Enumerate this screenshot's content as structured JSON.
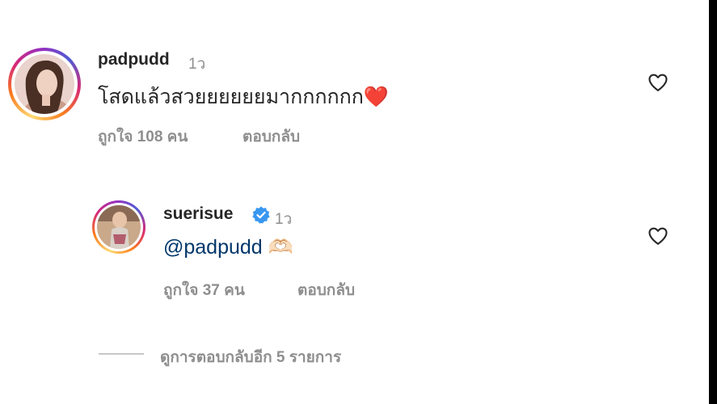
{
  "comment": {
    "username": "padpudd",
    "time": "1ว",
    "text": "โสดแล้วสวยยยยยยมากกกกกก",
    "emoji": "❤️",
    "likes": "ถูกใจ 108 คน",
    "reply_label": "ตอบกลับ"
  },
  "reply": {
    "username": "suerisue",
    "time": "1ว",
    "mention": "@padpudd",
    "emoji": "🫶🏻",
    "likes": "ถูกใจ 37 คน",
    "reply_label": "ตอบกลับ"
  },
  "view_more": "ดูการตอบกลับอีก 5 รายการ",
  "icons": {
    "like": "heart-outline-icon",
    "verified": "verified-badge-icon"
  },
  "colors": {
    "verified": "#3897f0",
    "mention": "#00376b",
    "secondary_text": "#8e8e8e"
  }
}
